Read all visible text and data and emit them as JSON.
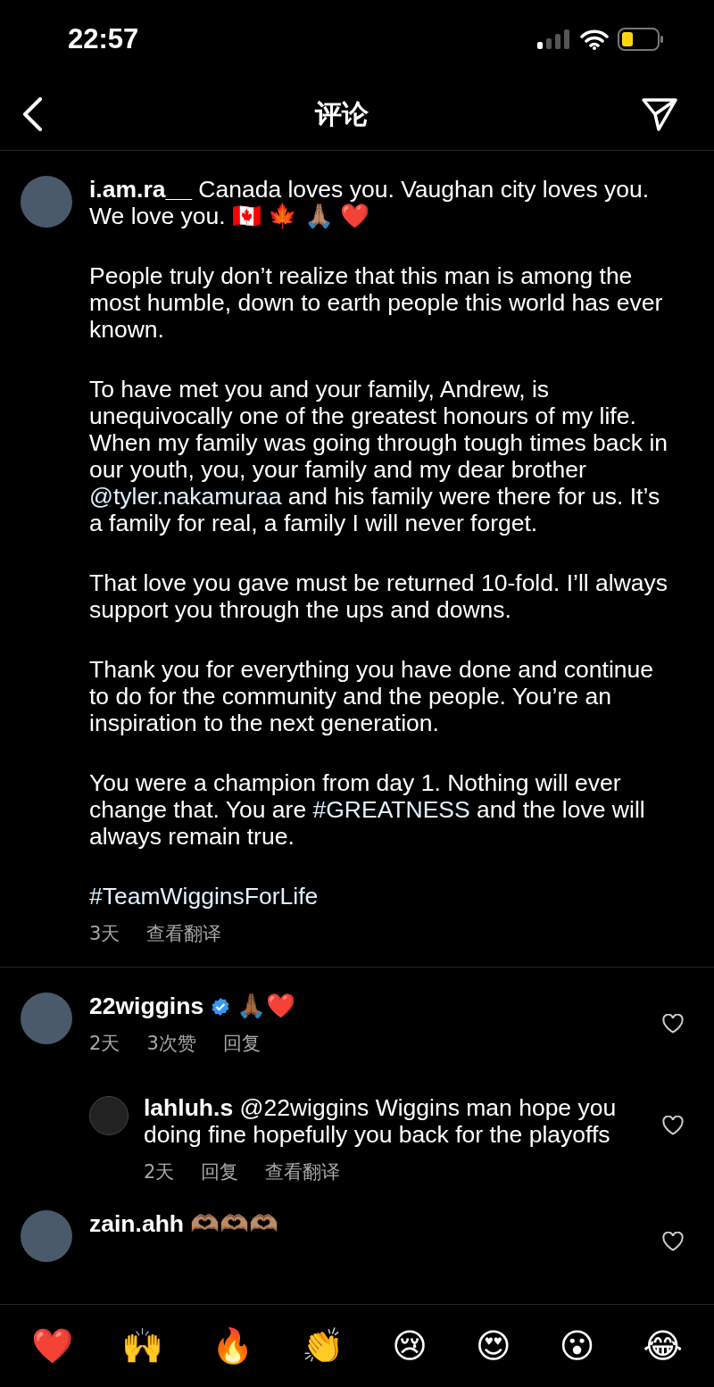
{
  "status_bar": {
    "time": "22:57"
  },
  "header": {
    "title": "评论"
  },
  "comments": [
    {
      "username": "i.am.ra__",
      "verified": false,
      "paragraphs": [
        [
          {
            "kind": "plain",
            "text": "Canada loves you. Vaughan city loves you. We love you. 🇨🇦 🍁 🙏🏽 ❤️"
          }
        ],
        [
          {
            "kind": "plain",
            "text": "People truly don’t realize that this man is among the most humble, down to earth people this world has ever known."
          }
        ],
        [
          {
            "kind": "plain",
            "text": "To have met you and your family, Andrew, is unequivocally one of the greatest honours of my life. When my family was going through tough times back in our youth, you, your family and my dear brother "
          },
          {
            "kind": "link",
            "text": "@tyler.nakamuraa"
          },
          {
            "kind": "plain",
            "text": " and his family were there for us. It’s a family for real, a family I will never forget."
          }
        ],
        [
          {
            "kind": "plain",
            "text": "That love you gave must be returned 10-fold. I’ll always support you through the ups and downs."
          }
        ],
        [
          {
            "kind": "plain",
            "text": "Thank you for everything you have done and continue to do for the community and the people. You’re an inspiration to the next generation."
          }
        ],
        [
          {
            "kind": "plain",
            "text": "You were a champion from day 1. Nothing will ever change that. You are "
          },
          {
            "kind": "link",
            "text": "#GREATNESS"
          },
          {
            "kind": "plain",
            "text": " and the love will always remain true."
          }
        ],
        [
          {
            "kind": "link",
            "text": "#TeamWigginsForLife"
          }
        ]
      ],
      "meta": [
        "3天",
        "查看翻译"
      ]
    },
    {
      "username": "22wiggins",
      "verified": true,
      "liked": false,
      "paragraphs": [
        [
          {
            "kind": "plain",
            "text": "🙏🏾❤️"
          }
        ]
      ],
      "meta": [
        "2天",
        "3次赞",
        "回复"
      ],
      "replies": [
        {
          "username": "lahluh.s",
          "verified": false,
          "liked": false,
          "paragraphs": [
            [
              {
                "kind": "plain",
                "text": "@22wiggins Wiggins man hope you doing fine hopefully you back for the playoffs"
              }
            ]
          ],
          "meta": [
            "2天",
            "回复",
            "查看翻译"
          ]
        }
      ]
    },
    {
      "username": "zain.ahh",
      "verified": false,
      "liked": false,
      "paragraphs": [
        [
          {
            "kind": "plain",
            "text": "🫶🏽🫶🏽🫶🏽"
          }
        ]
      ]
    }
  ],
  "reactions": [
    "❤️",
    "🙌",
    "🔥",
    "👏",
    "😢",
    "😍",
    "😮",
    "😂"
  ]
}
